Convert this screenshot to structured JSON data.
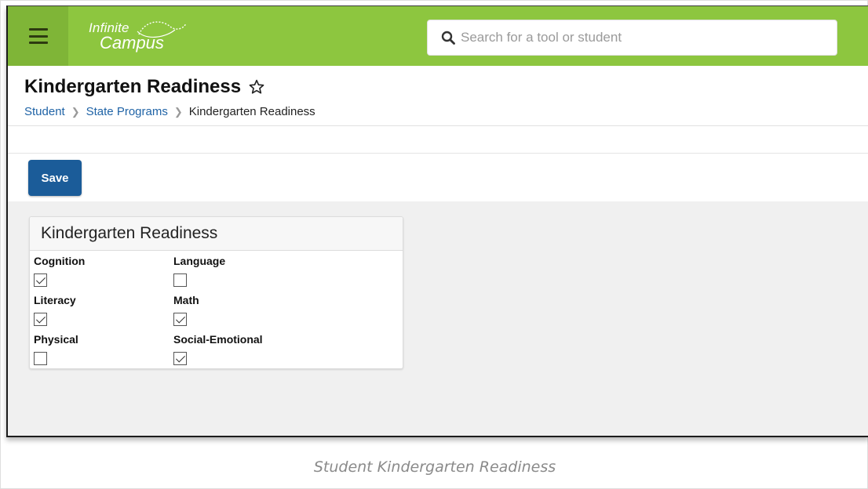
{
  "header": {
    "logo_line1": "Infinite",
    "logo_line2": "Campus",
    "search_placeholder": "Search for a tool or student",
    "colors": {
      "bar": "#8dc63f",
      "menu": "#7fb537"
    }
  },
  "page": {
    "title": "Kindergarten Readiness",
    "breadcrumb": [
      {
        "label": "Student",
        "link": true
      },
      {
        "label": "State Programs",
        "link": true
      },
      {
        "label": "Kindergarten Readiness",
        "link": false
      }
    ]
  },
  "toolbar": {
    "save_label": "Save",
    "save_color": "#1b5c99"
  },
  "panel": {
    "title": "Kindergarten Readiness",
    "fields": [
      {
        "label": "Cognition",
        "checked": true
      },
      {
        "label": "Language",
        "checked": false
      },
      {
        "label": "Literacy",
        "checked": true
      },
      {
        "label": "Math",
        "checked": true
      },
      {
        "label": "Physical",
        "checked": false
      },
      {
        "label": "Social-Emotional",
        "checked": true
      }
    ]
  },
  "caption": "Student Kindergarten Readiness"
}
